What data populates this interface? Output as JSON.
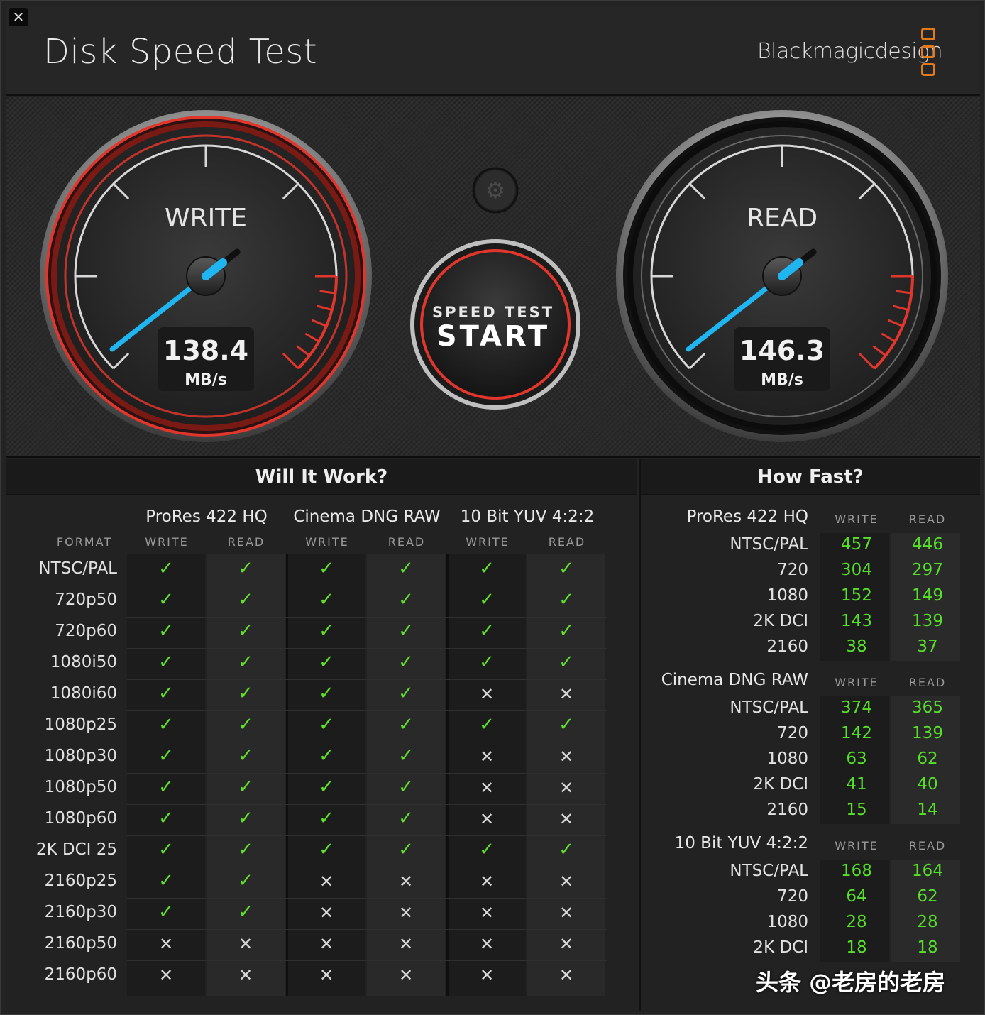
{
  "window": {
    "close_glyph": "✕"
  },
  "header": {
    "title": "Disk Speed Test",
    "brand": "Blackmagicdesign"
  },
  "gauges": {
    "write": {
      "label": "WRITE",
      "value": "138.4",
      "unit": "MB/s"
    },
    "read": {
      "label": "READ",
      "value": "146.3",
      "unit": "MB/s"
    },
    "settings_icon": "gear-icon",
    "start": {
      "line1": "SPEED TEST",
      "line2": "START"
    }
  },
  "will_it_work": {
    "title": "Will It Work?",
    "format_label": "FORMAT",
    "groups": [
      {
        "name": "ProRes 422 HQ",
        "write": "WRITE",
        "read": "READ"
      },
      {
        "name": "Cinema DNG RAW",
        "write": "WRITE",
        "read": "READ"
      },
      {
        "name": "10 Bit YUV 4:2:2",
        "write": "WRITE",
        "read": "READ"
      }
    ],
    "rows": [
      {
        "format": "NTSC/PAL",
        "marks": [
          1,
          1,
          1,
          1,
          1,
          1
        ]
      },
      {
        "format": "720p50",
        "marks": [
          1,
          1,
          1,
          1,
          1,
          1
        ]
      },
      {
        "format": "720p60",
        "marks": [
          1,
          1,
          1,
          1,
          1,
          1
        ]
      },
      {
        "format": "1080i50",
        "marks": [
          1,
          1,
          1,
          1,
          1,
          1
        ]
      },
      {
        "format": "1080i60",
        "marks": [
          1,
          1,
          1,
          1,
          0,
          0
        ]
      },
      {
        "format": "1080p25",
        "marks": [
          1,
          1,
          1,
          1,
          1,
          1
        ]
      },
      {
        "format": "1080p30",
        "marks": [
          1,
          1,
          1,
          1,
          0,
          0
        ]
      },
      {
        "format": "1080p50",
        "marks": [
          1,
          1,
          1,
          1,
          0,
          0
        ]
      },
      {
        "format": "1080p60",
        "marks": [
          1,
          1,
          1,
          1,
          0,
          0
        ]
      },
      {
        "format": "2K DCI 25",
        "marks": [
          1,
          1,
          1,
          1,
          1,
          1
        ]
      },
      {
        "format": "2160p25",
        "marks": [
          1,
          1,
          0,
          0,
          0,
          0
        ]
      },
      {
        "format": "2160p30",
        "marks": [
          1,
          1,
          0,
          0,
          0,
          0
        ]
      },
      {
        "format": "2160p50",
        "marks": [
          0,
          0,
          0,
          0,
          0,
          0
        ]
      },
      {
        "format": "2160p60",
        "marks": [
          0,
          0,
          0,
          0,
          0,
          0
        ]
      }
    ],
    "check_glyph": "✓",
    "cross_glyph": "✕"
  },
  "how_fast": {
    "title": "How Fast?",
    "sections": [
      {
        "name": "ProRes 422 HQ",
        "write": "WRITE",
        "read": "READ",
        "rows": [
          {
            "label": "NTSC/PAL",
            "write": "457",
            "read": "446"
          },
          {
            "label": "720",
            "write": "304",
            "read": "297"
          },
          {
            "label": "1080",
            "write": "152",
            "read": "149"
          },
          {
            "label": "2K DCI",
            "write": "143",
            "read": "139"
          },
          {
            "label": "2160",
            "write": "38",
            "read": "37"
          }
        ]
      },
      {
        "name": "Cinema DNG RAW",
        "write": "WRITE",
        "read": "READ",
        "rows": [
          {
            "label": "NTSC/PAL",
            "write": "374",
            "read": "365"
          },
          {
            "label": "720",
            "write": "142",
            "read": "139"
          },
          {
            "label": "1080",
            "write": "63",
            "read": "62"
          },
          {
            "label": "2K DCI",
            "write": "41",
            "read": "40"
          },
          {
            "label": "2160",
            "write": "15",
            "read": "14"
          }
        ]
      },
      {
        "name": "10 Bit YUV 4:2:2",
        "write": "WRITE",
        "read": "READ",
        "rows": [
          {
            "label": "NTSC/PAL",
            "write": "168",
            "read": "164"
          },
          {
            "label": "720",
            "write": "64",
            "read": "62"
          },
          {
            "label": "1080",
            "write": "28",
            "read": "28"
          },
          {
            "label": "2K DCI",
            "write": "18",
            "read": "18"
          }
        ]
      }
    ]
  },
  "watermark": "头条 @老房的老房",
  "colors": {
    "accent_red": "#e0362c",
    "needle_blue": "#1fb5f0",
    "ok_green": "#5fe02a",
    "logo_orange": "#e07a1f"
  }
}
